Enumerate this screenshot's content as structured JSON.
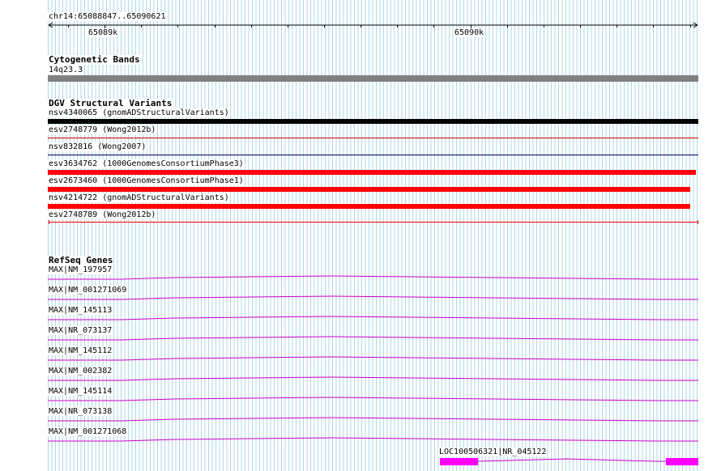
{
  "ruler": {
    "position_label": "chr14:65088847..65090621",
    "start": 65088847,
    "end": 65090621,
    "ticks": [
      {
        "value": 65089000,
        "label": "65089k"
      },
      {
        "value": 65090000,
        "label": "65090k"
      }
    ]
  },
  "tracks": {
    "cytoband": {
      "title": "Cytogenetic Bands",
      "band": "14q23.3",
      "color": "#808080"
    },
    "dgv": {
      "title": "DGV Structural Variants",
      "features": [
        {
          "label": "nsv4340065 (gnomADStructuralVariants)",
          "color": "#000000",
          "style": "thick"
        },
        {
          "label": "esv2748779 (Wong2012b)",
          "color": "#cc0000",
          "style": "thin"
        },
        {
          "label": "nsv832816 (Wong2007)",
          "color": "#000066",
          "style": "thin"
        },
        {
          "label": "esv3634762 (1000GenomesConsortiumPhase3)",
          "color": "#ff0000",
          "style": "thick"
        },
        {
          "label": "esv2673460 (1000GenomesConsortiumPhase1)",
          "color": "#ff0000",
          "style": "thick"
        },
        {
          "label": "nsv4214722 (gnomADStructuralVariants)",
          "color": "#ff0000",
          "style": "thick"
        },
        {
          "label": "esv2748789 (Wong2012b)",
          "color": "#ff0000",
          "style": "thin-capped"
        }
      ]
    },
    "refseq": {
      "title": "RefSeq Genes",
      "color": "#cc00cc",
      "transcripts": [
        "MAX|NM_197957",
        "MAX|NM_001271069",
        "MAX|NM_145113",
        "MAX|NR_073137",
        "MAX|NM_145112",
        "MAX|NM_002382",
        "MAX|NM_145114",
        "MAX|NR_073138",
        "MAX|NM_001271068"
      ],
      "extra_gene": {
        "label": "LOC100506321|NR_045122",
        "color": "#ff00ff"
      }
    }
  }
}
